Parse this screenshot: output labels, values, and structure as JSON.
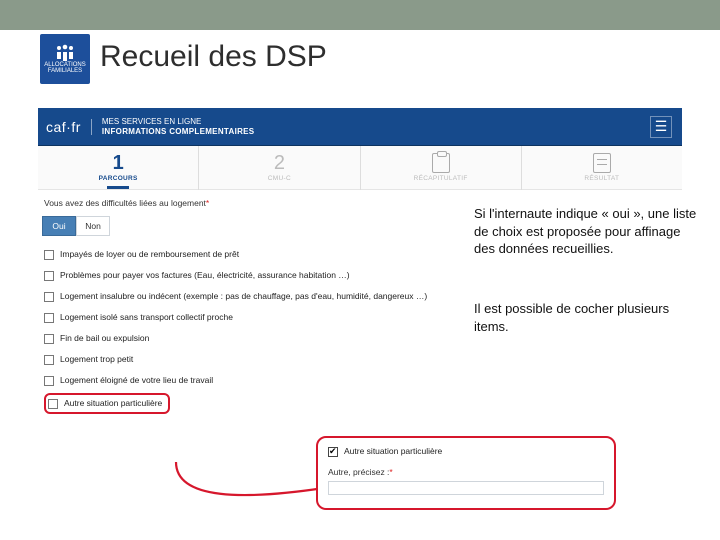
{
  "header": {
    "logo_text": "ALLOCATIONS FAMILIALES",
    "title": "Recueil des DSP"
  },
  "screenshot": {
    "brand": "caf·fr",
    "service_line1": "MES SERVICES EN LIGNE",
    "service_line2": "INFORMATIONS COMPLEMENTAIRES",
    "steps": {
      "s1_num": "1",
      "s1_label": "PARCOURS",
      "s2_num": "2",
      "s2_label": "CMU-C",
      "s3_label": "RÉCAPITULATIF",
      "s4_label": "RÉSULTAT"
    },
    "question": "Vous avez des difficultés liées au logement",
    "asterisk": "*",
    "oui": "Oui",
    "non": "Non",
    "options": [
      "Impayés de loyer ou de remboursement de prêt",
      "Problèmes pour payer vos factures (Eau, électricité, assurance habitation …)",
      "Logement insalubre ou indécent (exemple : pas de chauffage, pas d'eau, humidité, dangereux …)",
      "Logement isolé sans transport collectif proche",
      "Fin de bail ou expulsion",
      "Logement trop petit",
      "Logement éloigné de votre lieu de travail",
      "Autre situation particulière"
    ],
    "popup": {
      "checked_label": "Autre situation particulière",
      "precisez_label": "Autre, précisez :",
      "precisez_asterisk": "*"
    }
  },
  "callouts": {
    "c1": "Si l'internaute indique « oui », une liste de choix est proposée pour  affinage des données recueillies.",
    "c2": "Il est possible de cocher plusieurs items."
  }
}
